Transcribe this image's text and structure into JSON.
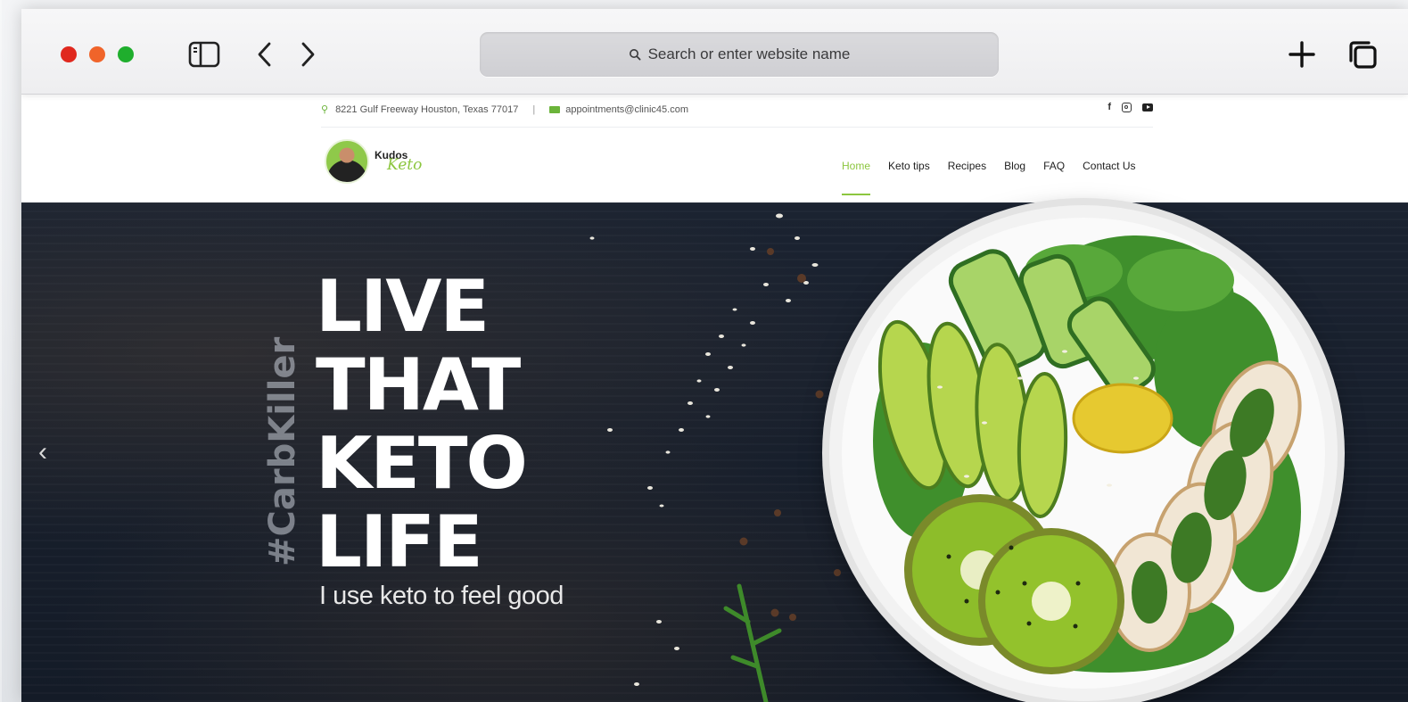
{
  "browser": {
    "address_placeholder": "Search or enter website name"
  },
  "site": {
    "address": "8221 Gulf Freeway Houston, Texas 77017",
    "separator": "|",
    "email": "appointments@clinic45.com",
    "social_facebook": "f",
    "logo": {
      "kudos": "Kudos",
      "keto": "Keto"
    },
    "nav": [
      {
        "label": "Home",
        "active": true
      },
      {
        "label": "Keto tips"
      },
      {
        "label": "Recipes"
      },
      {
        "label": "Blog"
      },
      {
        "label": "FAQ"
      },
      {
        "label": "Contact Us"
      }
    ],
    "accent_color": "#8cc63f"
  },
  "hero": {
    "lines": [
      "LIVE",
      "THAT",
      "KETO",
      "LIFE"
    ],
    "hashtag": "#CarbKiller",
    "tagline": "I use keto to feel good",
    "prev_arrow": "‹"
  }
}
